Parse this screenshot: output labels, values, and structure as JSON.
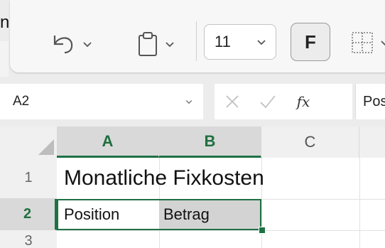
{
  "edge_text": "n",
  "ribbon": {
    "undo_icon": "undo-icon",
    "paste_icon": "clipboard-icon",
    "font_size": "11",
    "bold_label": "F",
    "borders_icon": "borders-icon"
  },
  "formula_bar": {
    "name_box": "A2",
    "cancel_icon": "cancel-icon",
    "enter_icon": "check-icon",
    "fx_label": "fx",
    "content": "Position"
  },
  "grid": {
    "columns": [
      "A",
      "B",
      "C"
    ],
    "rows": [
      "1",
      "2",
      "3"
    ],
    "cells": {
      "A1": "Monatliche Fixkosten",
      "A2": "Position",
      "B2": "Betrag"
    }
  },
  "colors": {
    "accent": "#1e7145",
    "selected_header": "#d9d9d9",
    "highlight_cell": "#d3d3d3"
  }
}
